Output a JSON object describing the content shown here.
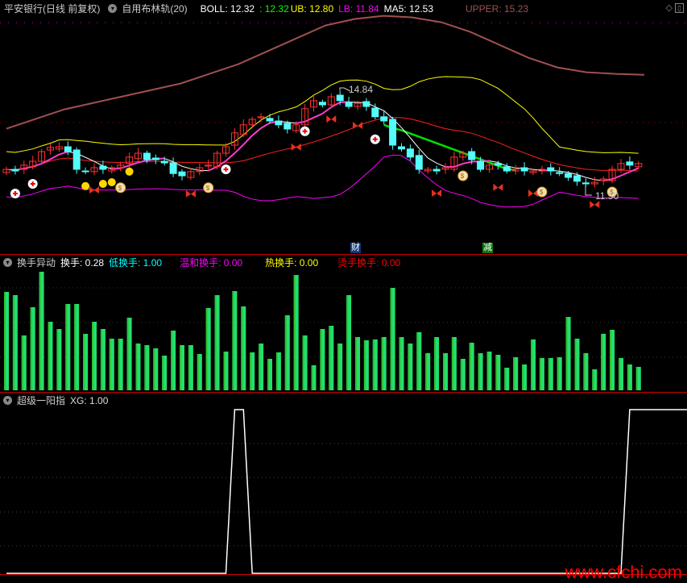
{
  "header": {
    "title": "平安银行(日线 前复权)",
    "indicator": "自用布林轨(20)",
    "boll": "BOLL: 12.32",
    "mid": ": 12.32",
    "ub": "UB: 12.80",
    "lb": "LB: 11.84",
    "ma5": "MA5: 12.53",
    "upper": "UPPER: 15.23",
    "icons": [
      "diamond-icon",
      "panel-toggle-icon"
    ]
  },
  "colors": {
    "up": "#ff3232",
    "down": "#54fcfc",
    "ma": "#ffffff",
    "ma_up": "#ff3cd0",
    "mid": "#ff2020",
    "ub": "#ffff00",
    "lb": "#ff00ff",
    "upper": "#a05050",
    "green": "#00e000",
    "vol": "#20e070"
  },
  "annotations": {
    "high_label": "14.84",
    "low_label": "11.50",
    "tag1": "财",
    "tag2": "减"
  },
  "volume_panel": {
    "title": "换手异动",
    "turnover": "换手: 0.28",
    "low": "低换手: 1.00",
    "mild": "温和换手: 0.00",
    "hot": "热换手: 0.00",
    "burn": "烫手换手: 0.00"
  },
  "xg_panel": {
    "title": "超级一阳指",
    "xg": "XG: 1.00"
  },
  "watermark": "www.cfchi.com",
  "chart_data": {
    "type": "candlestick",
    "closes": [
      12.34,
      12.29,
      12.47,
      12.59,
      12.89,
      13.02,
      13.04,
      12.89,
      12.34,
      12.27,
      12.39,
      12.34,
      12.39,
      12.47,
      12.72,
      12.84,
      12.64,
      12.64,
      12.54,
      12.21,
      12.14,
      12.27,
      12.39,
      12.47,
      12.84,
      13.04,
      13.47,
      13.72,
      13.89,
      13.97,
      13.84,
      13.72,
      13.59,
      13.72,
      14.22,
      14.47,
      14.34,
      14.59,
      14.47,
      14.29,
      14.39,
      14.29,
      13.97,
      13.84,
      13.09,
      12.97,
      12.72,
      12.34,
      12.34,
      12.29,
      12.39,
      12.72,
      12.84,
      12.64,
      12.34,
      12.47,
      12.47,
      12.29,
      12.34,
      12.29,
      12.29,
      12.34,
      12.29,
      12.21,
      12.09,
      11.97,
      11.89,
      11.94,
      12.04,
      12.34,
      12.52,
      12.47,
      12.52
    ],
    "upper_line": [
      13.6,
      13.9,
      14.2,
      14.4,
      14.6,
      14.8,
      15.0,
      15.3,
      15.6,
      16.0,
      16.4,
      16.8,
      17.0,
      17.1,
      17.05,
      16.9,
      16.6,
      16.2,
      15.8,
      15.5,
      15.35,
      15.3,
      15.27
    ],
    "green_line": {
      "start": 43,
      "values": [
        13.72,
        13.62,
        13.55,
        13.45,
        13.35,
        13.25,
        13.15,
        13.05,
        12.95,
        12.85,
        12.75,
        12.65,
        12.55,
        12.45,
        12.35,
        12.32
      ]
    },
    "volume": [
      122,
      118,
      68,
      103,
      147,
      85,
      76,
      107,
      107,
      70,
      85,
      76,
      64,
      64,
      90,
      58,
      56,
      52,
      43,
      74,
      56,
      56,
      45,
      102,
      118,
      48,
      123,
      104,
      47,
      58,
      39,
      47,
      93,
      143,
      68,
      31,
      76,
      80,
      58,
      118,
      66,
      62,
      63,
      66,
      127,
      66,
      58,
      72,
      46,
      66,
      46,
      66,
      39,
      59,
      46,
      48,
      44,
      28,
      41,
      32,
      63,
      40,
      40,
      41,
      91,
      64,
      46,
      26,
      70,
      75,
      40,
      32,
      29
    ],
    "xg": [
      0,
      0,
      0,
      0,
      0,
      0,
      0,
      0,
      0,
      0,
      0,
      0,
      0,
      0,
      0,
      0,
      0,
      0,
      0,
      0,
      0,
      0,
      0,
      0,
      0,
      0,
      1,
      1,
      0,
      0,
      0,
      0,
      0,
      0,
      0,
      0,
      0,
      0,
      0,
      0,
      0,
      0,
      0,
      0,
      0,
      0,
      0,
      0,
      0,
      0,
      0,
      0,
      0,
      0,
      0,
      0,
      0,
      0,
      0,
      0,
      0,
      0,
      0,
      0,
      0,
      0,
      0,
      0,
      0,
      0,
      0,
      1,
      1
    ],
    "markers": [
      {
        "i": 1,
        "type": "plus"
      },
      {
        "i": 3,
        "type": "plus"
      },
      {
        "i": 9,
        "type": "dot"
      },
      {
        "i": 10,
        "type": "butterfly"
      },
      {
        "i": 11,
        "type": "dot"
      },
      {
        "i": 12,
        "type": "dot"
      },
      {
        "i": 13,
        "type": "bag"
      },
      {
        "i": 14,
        "type": "dot"
      },
      {
        "i": 21,
        "type": "butterfly"
      },
      {
        "i": 23,
        "type": "bag"
      },
      {
        "i": 25,
        "type": "plus"
      },
      {
        "i": 33,
        "type": "butterfly"
      },
      {
        "i": 34,
        "type": "plus"
      },
      {
        "i": 37,
        "type": "butterfly"
      },
      {
        "i": 40,
        "type": "butterfly"
      },
      {
        "i": 42,
        "type": "plus"
      },
      {
        "i": 49,
        "type": "butterfly"
      },
      {
        "i": 52,
        "type": "bag"
      },
      {
        "i": 56,
        "type": "butterfly"
      },
      {
        "i": 60,
        "type": "butterfly"
      },
      {
        "i": 61,
        "type": "bag"
      },
      {
        "i": 67,
        "type": "butterfly"
      },
      {
        "i": 69,
        "type": "bag"
      }
    ]
  }
}
